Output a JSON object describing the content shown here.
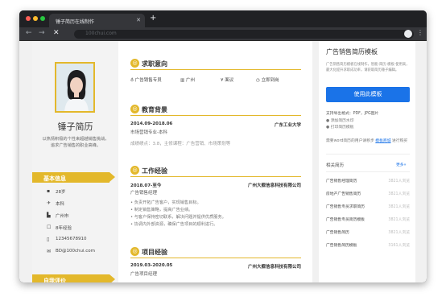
{
  "browser": {
    "tab_title": "锤子简历在线制作",
    "tab_close": "✕",
    "new_tab": "+",
    "url": "100chui.com"
  },
  "resume": {
    "name": "锤子简历",
    "intro": "以热情积极的个性来超越销售挑战，追求广告销售的职业高峰。",
    "basic_info_title": "基本信息",
    "basic_info": [
      {
        "icon": "user-icon",
        "glyph": "▪",
        "text": "28岁"
      },
      {
        "icon": "graduation-icon",
        "glyph": "✈",
        "text": "本科"
      },
      {
        "icon": "location-icon",
        "glyph": "▙",
        "text": "广州市"
      },
      {
        "icon": "briefcase-icon",
        "glyph": "☐",
        "text": "8年经验"
      },
      {
        "icon": "phone-icon",
        "glyph": "▯",
        "text": "12345678910"
      },
      {
        "icon": "mail-icon",
        "glyph": "✉",
        "text": "BD@100chui.com"
      }
    ],
    "self_eval_title": "自我评价",
    "job_intent": {
      "title": "求职意向",
      "items": [
        {
          "icon": "medal-icon",
          "glyph": "♁",
          "text": "广告销售专员"
        },
        {
          "icon": "building-icon",
          "glyph": "▥",
          "text": "广州"
        },
        {
          "icon": "money-icon",
          "glyph": "¥",
          "text": "面议"
        },
        {
          "icon": "clock-icon",
          "glyph": "◷",
          "text": "立即到岗"
        }
      ]
    },
    "education": {
      "title": "教育背景",
      "period": "2014.09-2018.06",
      "school": "广东工业大学",
      "major": "市场营销专业-本科",
      "detail": "成绩绩点：3.8，主修课程：广告营销、市场策划等"
    },
    "work": {
      "title": "工作经验",
      "period": "2018.07-至今",
      "company": "广州大舰信息科技有限公司",
      "position": "广告销售经理",
      "bullets": [
        "负责开拓广告客户，实现销售目标。",
        "制定销售策略，提高广告业绩。",
        "与客户保持密切联系，解决问题并提供优质服务。",
        "协调内外部资源，确保广告项目的顺利进行。"
      ]
    },
    "project": {
      "title": "项目经验",
      "period": "2019.03-2020.05",
      "company": "广州大舰信息科技有限公司",
      "position": "广告项目经理"
    }
  },
  "panel": {
    "title": "广告销售简历模板",
    "desc": "广告销售简历模板在线制作，智能-简历-模板-使用高，最大化提升求职成功率，请获取简历锤子编辑。",
    "use_button": "使用此模板",
    "export_formats": "支持导出格式：PDF，JPG图片",
    "export_opt1": "添加简历水印",
    "export_opt2": "打印简历模板",
    "download_word": "需要word简历的用户请移步",
    "download_link": "模板商城",
    "download_suffix": "进行购买",
    "related_title": "相关简历",
    "related_more": "更多»",
    "related": [
      {
        "name": "广告销售经理简历",
        "count": "3821人浏览"
      },
      {
        "name": "房地产广告销售简历",
        "count": "3821人浏览"
      },
      {
        "name": "广告销售专员求职简历",
        "count": "3821人浏览"
      },
      {
        "name": "广告销售专员简历模板",
        "count": "3821人浏览"
      },
      {
        "name": "广告销售简历",
        "count": "3821人浏览"
      },
      {
        "name": "广告销售简历模板",
        "count": "3161人浏览"
      }
    ]
  },
  "colors": {
    "accent": "#e3b82b",
    "primary": "#1a73e8"
  }
}
